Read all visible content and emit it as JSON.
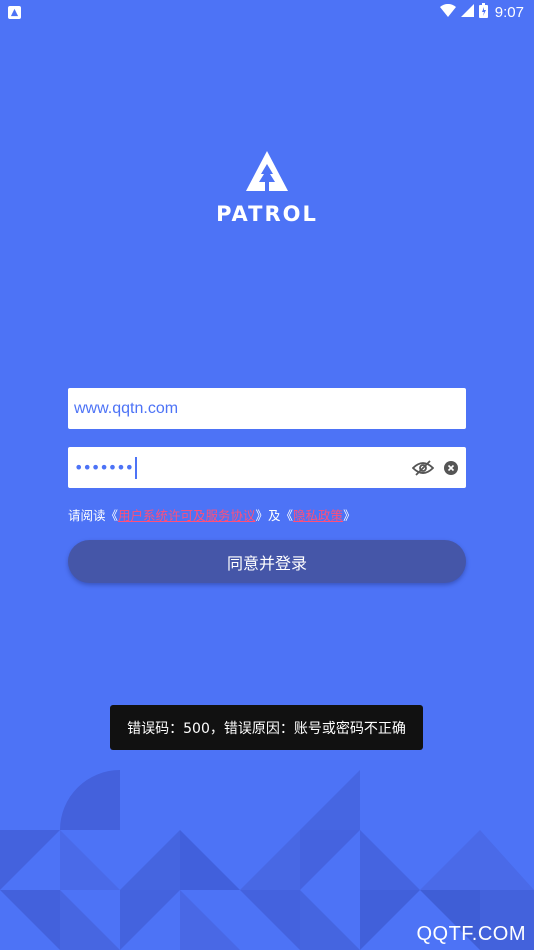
{
  "status_bar": {
    "time": "9:07",
    "notification_icon": "app-notification-icon",
    "wifi_icon": "wifi-icon",
    "signal_icon": "cellular-signal-icon",
    "battery_icon": "battery-icon"
  },
  "logo": {
    "text": "PATROL",
    "icon": "tree-triangle-logo-icon"
  },
  "login": {
    "username_value": "www.qqtn.com",
    "password_masked": "•••••••",
    "toggle_visibility_icon": "eye-slash-icon",
    "clear_icon": "clear-circle-icon",
    "agreement_prefix": "请阅读《",
    "agreement_link1": "用户系统许可及服务协议",
    "agreement_mid": "》及《",
    "agreement_link2": "隐私政策",
    "agreement_suffix": "》",
    "submit_label": "同意并登录"
  },
  "toast": {
    "message": "错误码：500，错误原因：账号或密码不正确"
  },
  "watermark": {
    "text": "QQTF.COM"
  },
  "colors": {
    "background": "#4d73f6",
    "button": "#4556a8",
    "link": "#ff4f7a",
    "toast": "#111111"
  }
}
